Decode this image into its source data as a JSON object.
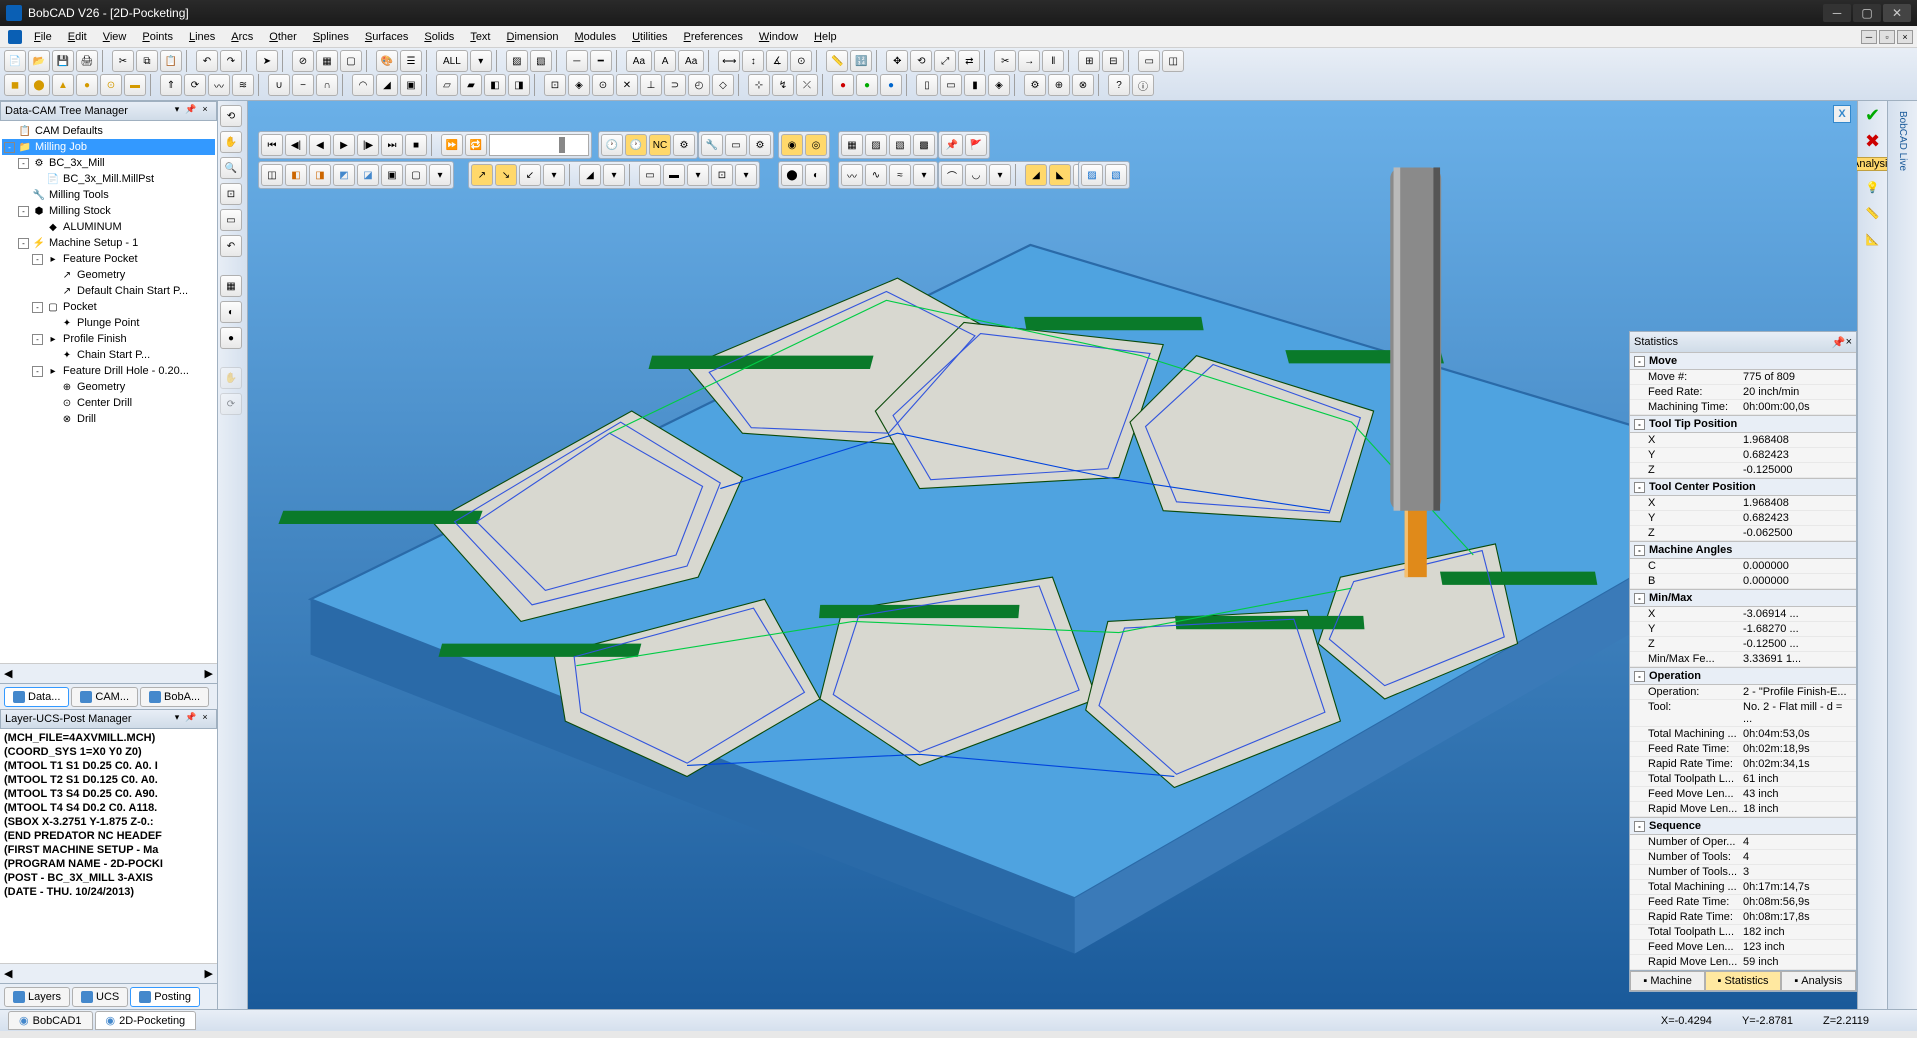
{
  "app": {
    "title": "BobCAD V26 - [2D-Pocketing]"
  },
  "menu": {
    "items": [
      "File",
      "Edit",
      "View",
      "Points",
      "Lines",
      "Arcs",
      "Other",
      "Splines",
      "Surfaces",
      "Solids",
      "Text",
      "Dimension",
      "Modules",
      "Utilities",
      "Preferences",
      "Window",
      "Help"
    ]
  },
  "toolbar": {
    "all_label": "ALL",
    "aa_label": "Aa",
    "aa2_label": "Aa"
  },
  "left": {
    "tree_panel_title": "Data-CAM Tree Manager",
    "tree": [
      {
        "d": 0,
        "exp": "",
        "ico": "📋",
        "label": "CAM Defaults",
        "sel": false
      },
      {
        "d": 0,
        "exp": "-",
        "ico": "📁",
        "label": "Milling Job",
        "sel": true
      },
      {
        "d": 1,
        "exp": "-",
        "ico": "⚙",
        "label": "BC_3x_Mill",
        "sel": false
      },
      {
        "d": 2,
        "exp": "",
        "ico": "📄",
        "label": "BC_3x_Mill.MillPst",
        "sel": false
      },
      {
        "d": 1,
        "exp": "",
        "ico": "🔧",
        "label": "Milling Tools",
        "sel": false
      },
      {
        "d": 1,
        "exp": "-",
        "ico": "⬢",
        "label": "Milling Stock",
        "sel": false
      },
      {
        "d": 2,
        "exp": "",
        "ico": "◆",
        "label": "ALUMINUM",
        "sel": false
      },
      {
        "d": 1,
        "exp": "-",
        "ico": "⚡",
        "label": "Machine Setup - 1",
        "sel": false
      },
      {
        "d": 2,
        "exp": "-",
        "ico": "▸",
        "label": "Feature Pocket",
        "sel": false
      },
      {
        "d": 3,
        "exp": "",
        "ico": "↗",
        "label": "Geometry",
        "sel": false
      },
      {
        "d": 3,
        "exp": "",
        "ico": "↗",
        "label": "Default Chain Start P...",
        "sel": false
      },
      {
        "d": 2,
        "exp": "-",
        "ico": "▢",
        "label": "Pocket",
        "sel": false
      },
      {
        "d": 3,
        "exp": "",
        "ico": "✦",
        "label": "Plunge Point",
        "sel": false
      },
      {
        "d": 2,
        "exp": "-",
        "ico": "▸",
        "label": "Profile Finish",
        "sel": false
      },
      {
        "d": 3,
        "exp": "",
        "ico": "✦",
        "label": "Chain Start P...",
        "sel": false
      },
      {
        "d": 2,
        "exp": "-",
        "ico": "▸",
        "label": "Feature Drill Hole - 0.20...",
        "sel": false
      },
      {
        "d": 3,
        "exp": "",
        "ico": "⊕",
        "label": "Geometry",
        "sel": false
      },
      {
        "d": 3,
        "exp": "",
        "ico": "⊙",
        "label": "Center Drill",
        "sel": false
      },
      {
        "d": 3,
        "exp": "",
        "ico": "⊗",
        "label": "Drill",
        "sel": false
      }
    ],
    "tree_tabs": [
      {
        "label": "Data...",
        "active": true
      },
      {
        "label": "CAM...",
        "active": false
      },
      {
        "label": "BobA...",
        "active": false
      }
    ],
    "post_panel_title": "Layer-UCS-Post Manager",
    "post_lines": [
      "(MCH_FILE=4AXVMILL.MCH)",
      "(COORD_SYS 1=X0 Y0 Z0)",
      "(MTOOL T1 S1 D0.25 C0. A0. I",
      "(MTOOL T2 S1 D0.125 C0. A0.",
      "(MTOOL T3 S4 D0.25 C0. A90.",
      "(MTOOL T4 S4 D0.2 C0. A118.",
      "(SBOX X-3.2751 Y-1.875 Z-0.:",
      "(END PREDATOR NC HEADEF",
      "",
      "(FIRST MACHINE SETUP - Ma",
      "",
      "(PROGRAM NAME - 2D-POCKI",
      "(POST -  BC_3X_MILL 3-AXIS",
      "(DATE - THU. 10/24/2013)"
    ],
    "post_tabs": [
      {
        "label": "Layers",
        "active": false
      },
      {
        "label": "UCS",
        "active": false
      },
      {
        "label": "Posting",
        "active": true
      }
    ]
  },
  "viewport": {
    "close_label": "X"
  },
  "stats": {
    "title": "Statistics",
    "sections": [
      {
        "name": "Move",
        "rows": [
          {
            "k": "Move #:",
            "v": "775 of 809"
          },
          {
            "k": "Feed Rate:",
            "v": "20 inch/min"
          },
          {
            "k": "Machining Time:",
            "v": "0h:00m:00,0s"
          }
        ]
      },
      {
        "name": "Tool Tip Position",
        "rows": [
          {
            "k": "X",
            "v": "1.968408"
          },
          {
            "k": "Y",
            "v": "0.682423"
          },
          {
            "k": "Z",
            "v": "-0.125000"
          }
        ]
      },
      {
        "name": "Tool Center Position",
        "rows": [
          {
            "k": "X",
            "v": "1.968408"
          },
          {
            "k": "Y",
            "v": "0.682423"
          },
          {
            "k": "Z",
            "v": "-0.062500"
          }
        ]
      },
      {
        "name": "Machine Angles",
        "rows": [
          {
            "k": "C",
            "v": "0.000000"
          },
          {
            "k": "B",
            "v": "0.000000"
          }
        ]
      },
      {
        "name": "Min/Max",
        "rows": [
          {
            "k": "X",
            "v": "-3.06914   ..."
          },
          {
            "k": "Y",
            "v": "-1.68270   ..."
          },
          {
            "k": "Z",
            "v": "-0.12500   ..."
          },
          {
            "k": "Min/Max Fe...",
            "v": "3.33691   1..."
          }
        ]
      },
      {
        "name": "Operation",
        "rows": [
          {
            "k": "Operation:",
            "v": "2 - \"Profile Finish-E..."
          },
          {
            "k": "Tool:",
            "v": "No. 2 - Flat mill - d = ..."
          },
          {
            "k": "Total Machining ...",
            "v": "0h:04m:53,0s"
          },
          {
            "k": "Feed Rate Time:",
            "v": "0h:02m:18,9s"
          },
          {
            "k": "Rapid Rate Time:",
            "v": "0h:02m:34,1s"
          },
          {
            "k": "Total Toolpath L...",
            "v": "61 inch"
          },
          {
            "k": "Feed Move Len...",
            "v": "43 inch"
          },
          {
            "k": "Rapid Move Len...",
            "v": "18 inch"
          }
        ]
      },
      {
        "name": "Sequence",
        "rows": [
          {
            "k": "Number of Oper...",
            "v": "4"
          },
          {
            "k": "Number of Tools:",
            "v": "4"
          },
          {
            "k": "Number of Tools...",
            "v": "3"
          },
          {
            "k": "Total Machining ...",
            "v": "0h:17m:14,7s"
          },
          {
            "k": "Feed Rate Time:",
            "v": "0h:08m:56,9s"
          },
          {
            "k": "Rapid Rate Time:",
            "v": "0h:08m:17,8s"
          },
          {
            "k": "Total Toolpath L...",
            "v": "182 inch"
          },
          {
            "k": "Feed Move Len...",
            "v": "123 inch"
          },
          {
            "k": "Rapid Move Len...",
            "v": "59 inch"
          }
        ]
      }
    ],
    "tabs": [
      {
        "label": "Machine",
        "active": false
      },
      {
        "label": "Statistics",
        "active": true
      },
      {
        "label": "Analysis",
        "active": false
      }
    ]
  },
  "right": {
    "vtext1": "BobCAD Live",
    "vtext2": "Analysis"
  },
  "status": {
    "docs": [
      {
        "label": "BobCAD1",
        "active": false
      },
      {
        "label": "2D-Pocketing",
        "active": true
      }
    ],
    "coords": {
      "x": "X=-0.4294",
      "y": "Y=-2.8781",
      "z": "Z=2.2119"
    }
  }
}
